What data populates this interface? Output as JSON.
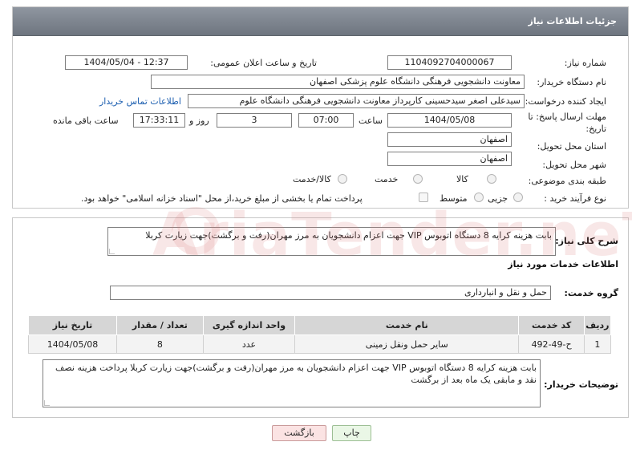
{
  "header": {
    "title": "جزئیات اطلاعات نیاز"
  },
  "form": {
    "need_number": {
      "label": "شماره نیاز:",
      "value": "1104092704000067"
    },
    "announce_datetime": {
      "label": "تاریخ و ساعت اعلان عمومی:",
      "value": "1404/05/04 - 12:37"
    },
    "buyer_org": {
      "label": "نام دستگاه خریدار:",
      "value": "معاونت دانشجویی فرهنگی دانشگاه علوم پزشکی اصفهان"
    },
    "requester": {
      "label": "ایجاد کننده درخواست:",
      "value": "سیدعلی اصغر سیدحسینی کارپرداز معاونت دانشجویی فرهنگی دانشگاه علوم",
      "contact_link": "اطلاعات تماس خریدار"
    },
    "deadline": {
      "label_line1": "مهلت ارسال پاسخ: تا",
      "label_line2": "تاریخ:",
      "date": "1404/05/08",
      "time_label": "ساعت",
      "time": "07:00",
      "days": "3",
      "days_label": "روز و",
      "remaining": "17:33:11",
      "remaining_label": "ساعت باقی مانده"
    },
    "province": {
      "label": "استان محل تحویل:",
      "value": "اصفهان"
    },
    "city": {
      "label": "شهر محل تحویل:",
      "value": "اصفهان"
    },
    "category": {
      "label": "طبقه بندی موضوعی:",
      "options": [
        "کالا",
        "خدمت",
        "کالا/خدمت"
      ]
    },
    "process": {
      "label": "نوع فرآیند خرید :",
      "options": [
        "جزیی",
        "متوسط"
      ],
      "payment_note": "پرداخت تمام یا بخشی از مبلغ خرید،از محل \"اسناد خزانه اسلامی\" خواهد بود."
    }
  },
  "section2": {
    "summary_label": "شرح کلی نیاز:",
    "summary": "بابت هزینه کرایه 8 دستگاه اتوبوس VIP جهت اعزام دانشجویان به مرز مهران(رفت و برگشت)جهت زیارت کربلا",
    "services_title": "اطلاعات خدمات مورد نیاز",
    "group_label": "گروه خدمت:",
    "group_value": "حمل و نقل و انبارداری",
    "table": {
      "headers": [
        "ردیف",
        "کد خدمت",
        "نام خدمت",
        "واحد اندازه گیری",
        "تعداد / مقدار",
        "تاریخ نیاز"
      ],
      "rows": [
        [
          "1",
          "ح-49-492",
          "سایر حمل ونقل زمینی",
          "عدد",
          "8",
          "1404/05/08"
        ]
      ]
    },
    "buyer_notes_label": "توضیحات خریدار:",
    "buyer_notes": "بابت هزینه کرایه 8 دستگاه اتوبوس VIP جهت اعزام دانشجویان به مرز مهران(رفت و برگشت)جهت زیارت کربلا پرداخت هزینه نصف نقد و مابقی یک ماه بعد از برگشت"
  },
  "buttons": {
    "print": "چاپ",
    "back": "بازگشت"
  },
  "watermark": "AriaTender.neT"
}
